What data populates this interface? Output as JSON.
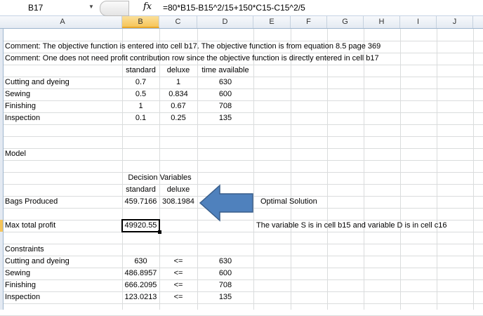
{
  "formula_bar": {
    "name_box": "B17",
    "fx": "fx",
    "formula": "=80*B15-B15^2/15+150*C15-C15^2/5"
  },
  "columns": [
    "A",
    "B",
    "C",
    "D",
    "E",
    "F",
    "G",
    "H",
    "I",
    "J"
  ],
  "selected_column": "B",
  "comments": [
    "Comment: The objective function is entered into cell b17. The objective function is from equation 8.5 page 369",
    "Comment: One does not need profit contribution row since the objective function is directly entered in cell b17"
  ],
  "resource_table": {
    "headers": [
      "standard",
      "deluxe",
      "time available"
    ],
    "rows": [
      {
        "label": "Cutting and dyeing",
        "standard": "0.7",
        "deluxe": "1",
        "time": "630"
      },
      {
        "label": "Sewing",
        "standard": "0.5",
        "deluxe": "0.834",
        "time": "600"
      },
      {
        "label": "Finishing",
        "standard": "1",
        "deluxe": "0.67",
        "time": "708"
      },
      {
        "label": "Inspection",
        "standard": "0.1",
        "deluxe": "0.25",
        "time": "135"
      }
    ]
  },
  "model_label": "Model",
  "decision_variables": {
    "title": "Decision Variables",
    "headers": [
      "standard",
      "deluxe"
    ],
    "label": "Bags Produced",
    "standard": "459.7166",
    "deluxe": "308.1984",
    "note": "Optimal Solution"
  },
  "profit": {
    "label": "Max total profit",
    "value": "49920.55",
    "note": "The variable S is in cell b15 and variable D is in cell c16"
  },
  "constraints": {
    "title": "Constraints",
    "rows": [
      {
        "label": "Cutting and dyeing",
        "lhs": "630",
        "op": "<=",
        "rhs": "630"
      },
      {
        "label": "Sewing",
        "lhs": "486.8957",
        "op": "<=",
        "rhs": "600"
      },
      {
        "label": "Finishing",
        "lhs": "666.2095",
        "op": "<=",
        "rhs": "708"
      },
      {
        "label": "Inspection",
        "lhs": "123.0213",
        "op": "<=",
        "rhs": "135"
      }
    ]
  },
  "colors": {
    "arrow": "#4f81bd",
    "selection": "#f6c55a"
  }
}
